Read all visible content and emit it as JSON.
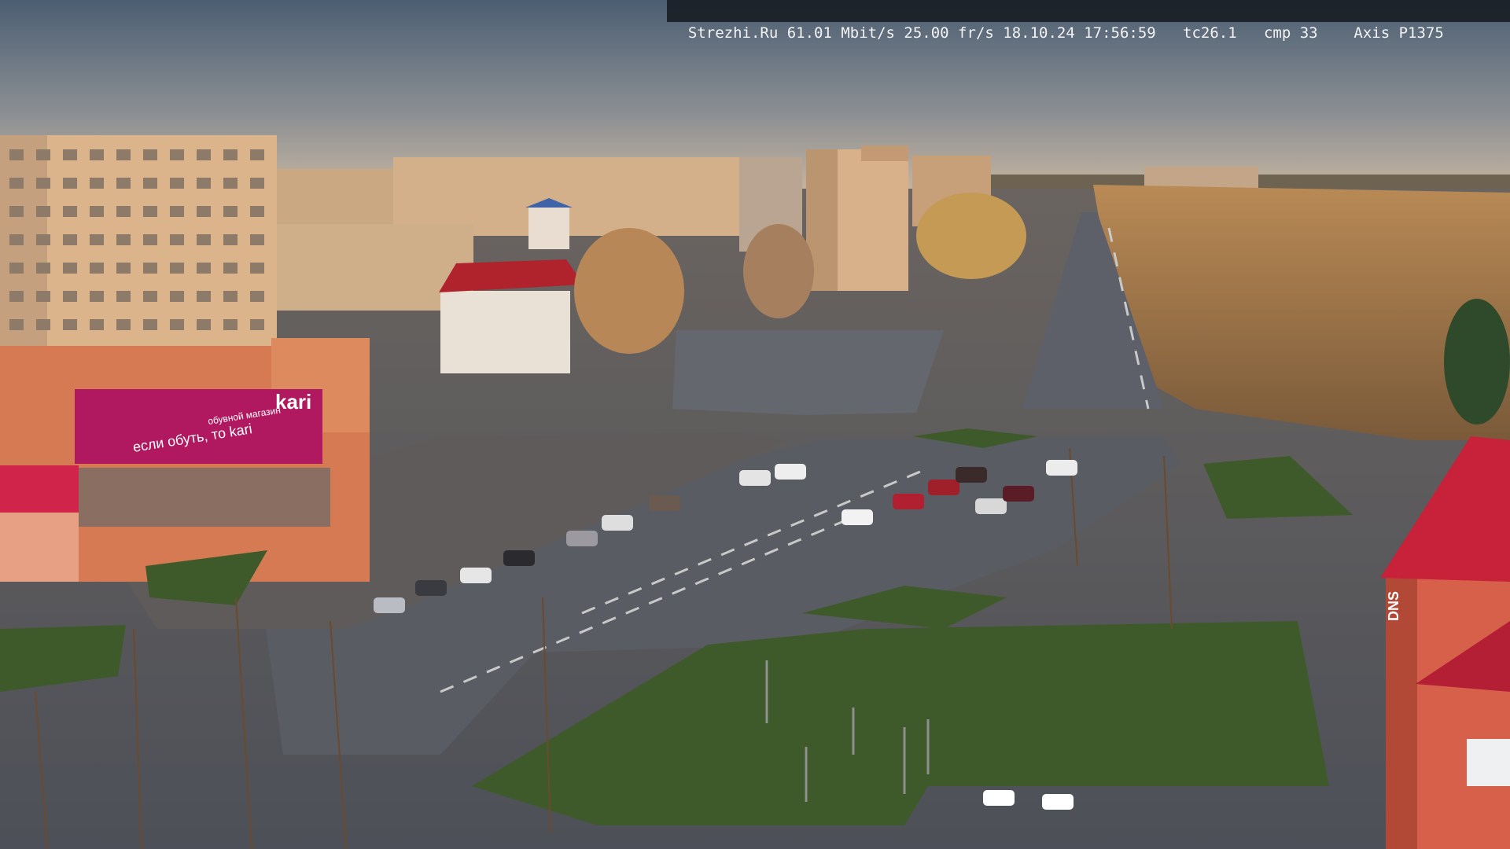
{
  "camera_overlay": {
    "text": "Strezhi.Ru 61.01 Mbit/s 25.00 fr/s 18.10.24 17:56:59   tc26.1   cmp 33    Axis P1375"
  },
  "signage": {
    "store_brand": "kari",
    "store_tagline": "если обуть, то kari",
    "store_side": "обувной магазин",
    "tower_sign": "DNS"
  },
  "colors": {
    "sky_top": "#4c5e72",
    "sky_bottom": "#b8b0a4",
    "road": "#5b5f66",
    "grass": "#3f5a2a",
    "building_sunlit": "#d9b48a",
    "kari_magenta": "#b0195f"
  }
}
